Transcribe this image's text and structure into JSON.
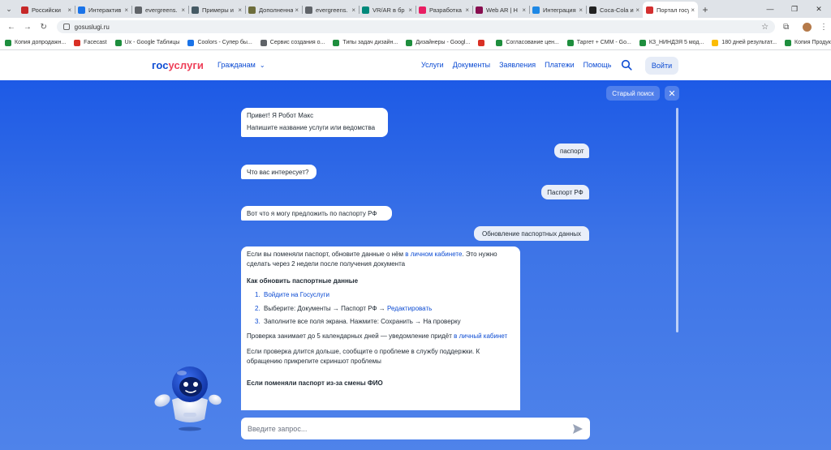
{
  "browser": {
    "tabs": [
      {
        "title": "Российски",
        "color": "#c62828"
      },
      {
        "title": "Интерактив",
        "color": "#1a73e8"
      },
      {
        "title": "evergreens.",
        "color": "#5f6368"
      },
      {
        "title": "Примеры и",
        "color": "#455a64"
      },
      {
        "title": "Дополненна",
        "color": "#6d6d3b"
      },
      {
        "title": "evergreens.",
        "color": "#5f6368"
      },
      {
        "title": "VR/AR в бр",
        "color": "#00897b"
      },
      {
        "title": "Разработка",
        "color": "#e91e63"
      },
      {
        "title": "Web AR | Н",
        "color": "#880e4f"
      },
      {
        "title": "Интеграция",
        "color": "#1e88e5"
      },
      {
        "title": "Coca-Cola и",
        "color": "#212121"
      },
      {
        "title": "Портал госу",
        "color": "#d32f2f"
      }
    ],
    "active_tab_index": 11,
    "url": "gosuslugi.ru",
    "bookmarks": [
      {
        "label": "Копия допродажн...",
        "color": "#1e8e3e"
      },
      {
        "label": "Facecast",
        "color": "#d93025"
      },
      {
        "label": "Ux - Google Таблицы",
        "color": "#1e8e3e"
      },
      {
        "label": "Coolors - Супер бы...",
        "color": "#1a73e8"
      },
      {
        "label": "Сервис создания о...",
        "color": "#5f6368"
      },
      {
        "label": "Типы задач дизайн...",
        "color": "#1e8e3e"
      },
      {
        "label": "Дизайнеры - Googl...",
        "color": "#1e8e3e"
      },
      {
        "label": "",
        "color": "#d93025"
      },
      {
        "label": "Согласование цен...",
        "color": "#1e8e3e"
      },
      {
        "label": "Таргет + СММ - Go...",
        "color": "#1e8e3e"
      },
      {
        "label": "КЗ_НИНДЗЯ 5 мод...",
        "color": "#1e8e3e"
      },
      {
        "label": "180 дней результат...",
        "color": "#fbbc04"
      },
      {
        "label": "Копия Продуктовы...",
        "color": "#1e8e3e"
      }
    ]
  },
  "header": {
    "logo_part1": "гос",
    "logo_part2": "услуги",
    "audience": "Гражданам",
    "nav": [
      "Услуги",
      "Документы",
      "Заявления",
      "Платежи",
      "Помощь"
    ],
    "login": "Войти"
  },
  "chat": {
    "old_search": "Старый поиск",
    "greeting_line1": "Привет! Я Робот Макс",
    "greeting_line2": "Напишите название услуги или ведомства",
    "user_msg1": "паспорт",
    "bot_msg2": "Что вас интересует?",
    "user_msg2": "Паспорт РФ",
    "bot_msg3": "Вот что я могу предложить по паспорту РФ",
    "user_msg3": "Обновление паспортных данных",
    "answer": {
      "p1_text": "Если вы поменяли паспорт, обновите данные о нём ",
      "p1_link": "в личном кабинете",
      "p1_rest": ". Это нужно сделать через 2 недели после получения документа",
      "heading": "Как обновить паспортные данные",
      "step1_num": "1.",
      "step1_link": "Войдите на Госуслуги",
      "step2_num": "2.",
      "step2_text": "Выберите: Документы → Паспорт РФ → ",
      "step2_link": "Редактировать",
      "step3_num": "3.",
      "step3_text": "Заполните все поля экрана. Нажмите: Сохранить → На проверку",
      "p2_text": "Проверка занимает до 5 календарных дней — уведомление придёт ",
      "p2_link": "в личный кабинет",
      "p3_text": "Если проверка длится дольше, сообщите о проблеме в службу поддержки. К обращению прикрепите скриншот проблемы",
      "heading2": "Если поменяли паспорт из-за смены ФИО"
    },
    "input_placeholder": "Введите запрос..."
  },
  "colors": {
    "brand_blue": "#0d4cd3",
    "brand_red": "#ee3f58",
    "chat_bg": "#3d74e7"
  }
}
